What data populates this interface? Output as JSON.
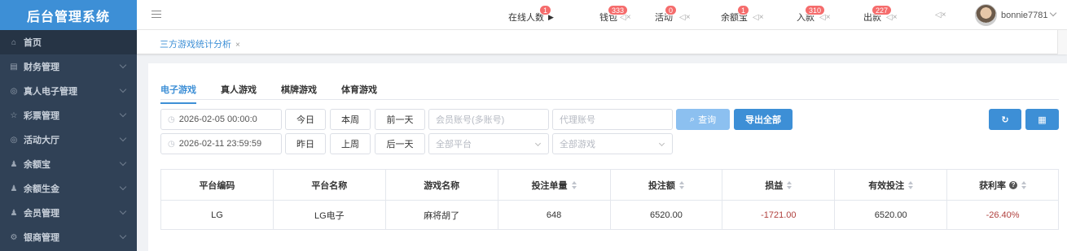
{
  "app": {
    "title": "后台管理系统"
  },
  "sidebar": {
    "items": [
      {
        "icon": "home-icon",
        "glyph": "⌂",
        "label": "首页"
      },
      {
        "icon": "finance-icon",
        "glyph": "▤",
        "label": "财务管理"
      },
      {
        "icon": "live-game-icon",
        "glyph": "◎",
        "label": "真人电子管理"
      },
      {
        "icon": "lottery-icon",
        "glyph": "☆",
        "label": "彩票管理"
      },
      {
        "icon": "activity-icon",
        "glyph": "◎",
        "label": "活动大厅"
      },
      {
        "icon": "yuebao-icon",
        "glyph": "♟",
        "label": "余额宝"
      },
      {
        "icon": "yuesheng-icon",
        "glyph": "♟",
        "label": "余额生金"
      },
      {
        "icon": "member-icon",
        "glyph": "♟",
        "label": "会员管理"
      },
      {
        "icon": "bank-icon",
        "glyph": "⚙",
        "label": "银商管理"
      }
    ]
  },
  "header": {
    "online": {
      "label": "在线人数",
      "badge": "1"
    },
    "wallet": {
      "label": "钱包",
      "badge": "333"
    },
    "activity": {
      "label": "活动",
      "badge": "0"
    },
    "yuebao": {
      "label": "余额宝",
      "badge": "1"
    },
    "deposit": {
      "label": "入款",
      "badge": "310"
    },
    "withdraw": {
      "label": "出款",
      "badge": "227"
    },
    "user": {
      "name": "bonnie7781"
    }
  },
  "tagsbar": {
    "active_tag": "三方游戏统计分析",
    "close": "×"
  },
  "tabs": [
    "电子游戏",
    "真人游戏",
    "棋牌游戏",
    "体育游戏"
  ],
  "filters": {
    "start_time": "2026-02-05 00:00:0",
    "end_time": "2026-02-11 23:59:59",
    "btn_today": "今日",
    "btn_week": "本周",
    "btn_prev_day": "前一天",
    "btn_yesterday": "昨日",
    "btn_last_week": "上周",
    "btn_next_day": "后一天",
    "member_placeholder": "会员账号(多账号)",
    "agent_placeholder": "代理账号",
    "platform_select": "全部平台",
    "game_select": "全部游戏",
    "btn_search": "查询",
    "btn_export": "导出全部"
  },
  "table": {
    "headers": [
      "平台编码",
      "平台名称",
      "游戏名称",
      "投注单量",
      "投注额",
      "损益",
      "有效投注",
      "获利率"
    ],
    "rows": [
      [
        "LG",
        "LG电子",
        "麻将胡了",
        "648",
        "6520.00",
        "-1721.00",
        "6520.00",
        "-26.40%"
      ]
    ]
  },
  "colors": {
    "accent": "#3d8fd6",
    "sidebar_bg": "#304156",
    "negative": "#b0413e",
    "badge": "#f56c6c"
  }
}
